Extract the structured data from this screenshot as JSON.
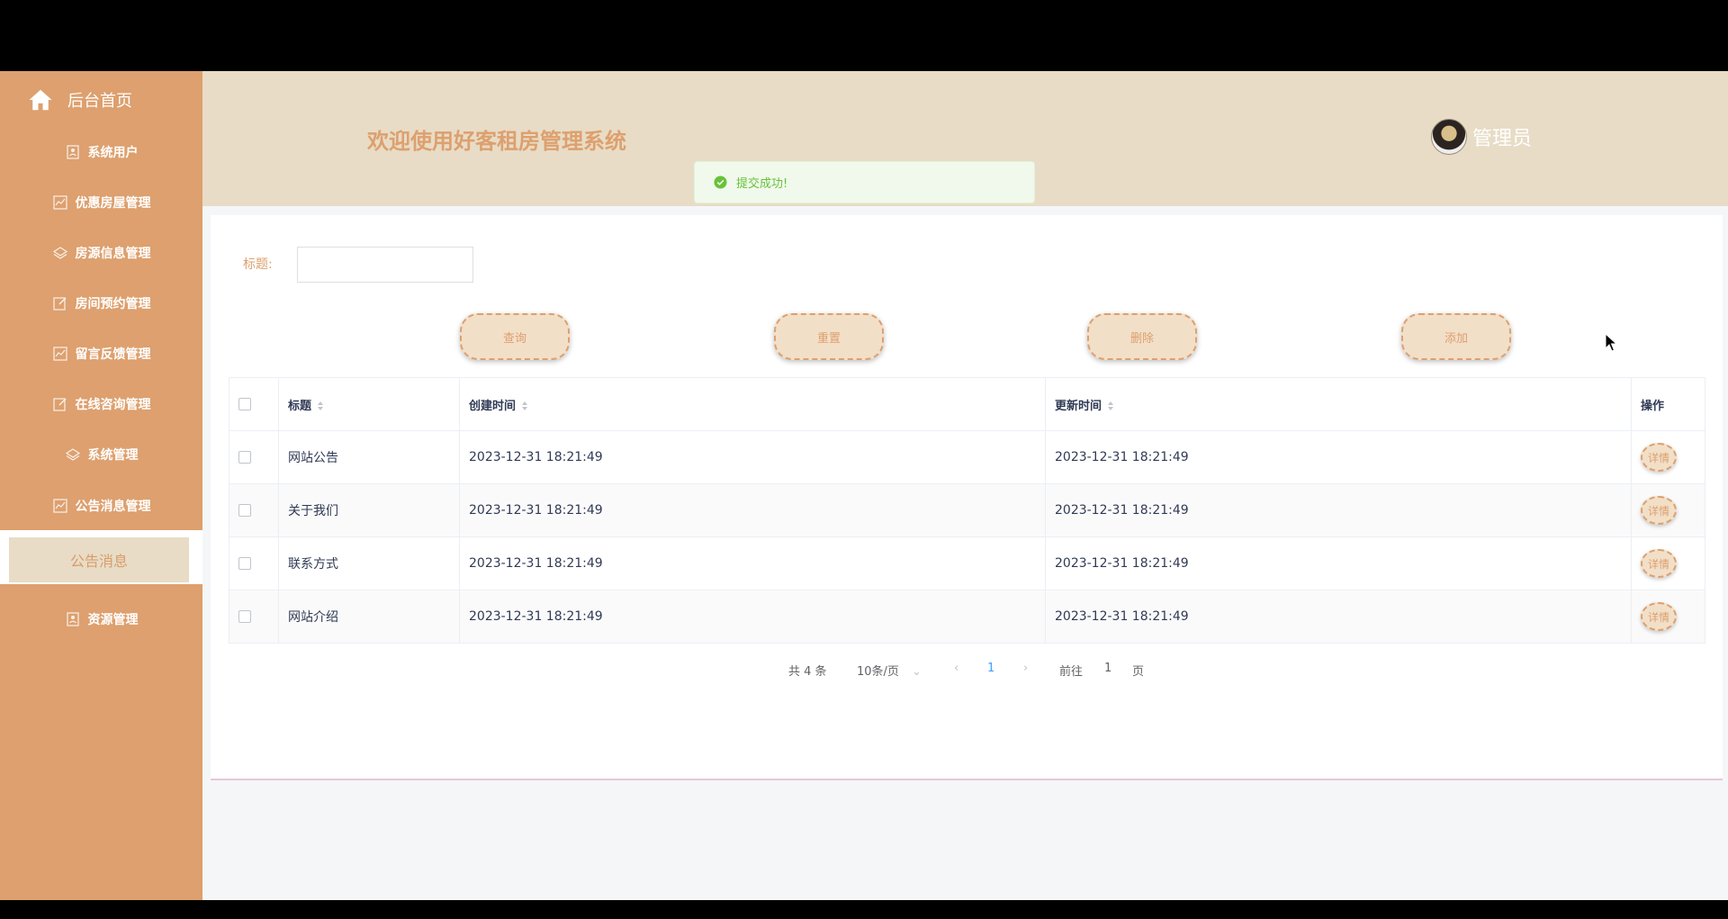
{
  "sidebar": {
    "home": {
      "label": "后台首页",
      "icon": "home-icon"
    },
    "items": [
      {
        "label": "系统用户",
        "icon": "user-card-icon"
      },
      {
        "label": "优惠房屋管理",
        "icon": "chart-icon"
      },
      {
        "label": "房源信息管理",
        "icon": "layers-icon"
      },
      {
        "label": "房间预约管理",
        "icon": "edit-icon"
      },
      {
        "label": "留言反馈管理",
        "icon": "chart-icon"
      },
      {
        "label": "在线咨询管理",
        "icon": "edit-icon"
      },
      {
        "label": "系统管理",
        "icon": "layers-icon"
      },
      {
        "label": "公告消息管理",
        "icon": "chart-icon"
      },
      {
        "label": "资源管理",
        "icon": "user-card-icon"
      }
    ],
    "active_sub": {
      "label": "公告消息"
    }
  },
  "header": {
    "title": "欢迎使用好客租房管理系统",
    "user": {
      "name": "管理员"
    }
  },
  "toast": {
    "text": "提交成功!",
    "type": "success"
  },
  "search": {
    "label": "标题:",
    "value": "",
    "placeholder": ""
  },
  "buttons": {
    "query": "查询",
    "reset": "重置",
    "delete": "删除",
    "add": "添加"
  },
  "table": {
    "columns": [
      "标题",
      "创建时间",
      "更新时间",
      "操作"
    ],
    "rows": [
      {
        "title": "网站公告",
        "created": "2023-12-31 18:21:49",
        "updated": "2023-12-31 18:21:49",
        "action": "详情"
      },
      {
        "title": "关于我们",
        "created": "2023-12-31 18:21:49",
        "updated": "2023-12-31 18:21:49",
        "action": "详情"
      },
      {
        "title": "联系方式",
        "created": "2023-12-31 18:21:49",
        "updated": "2023-12-31 18:21:49",
        "action": "详情"
      },
      {
        "title": "网站介绍",
        "created": "2023-12-31 18:21:49",
        "updated": "2023-12-31 18:21:49",
        "action": "详情"
      }
    ]
  },
  "pagination": {
    "total": "共 4 条",
    "page_size": "10条/页",
    "current_page": "1",
    "goto_prefix": "前往",
    "goto_value": "1",
    "goto_suffix": "页"
  },
  "colors": {
    "sidebar": "#dda06e",
    "header": "#e8dcc6",
    "accent": "#dda06e",
    "success": "#67c23a"
  }
}
